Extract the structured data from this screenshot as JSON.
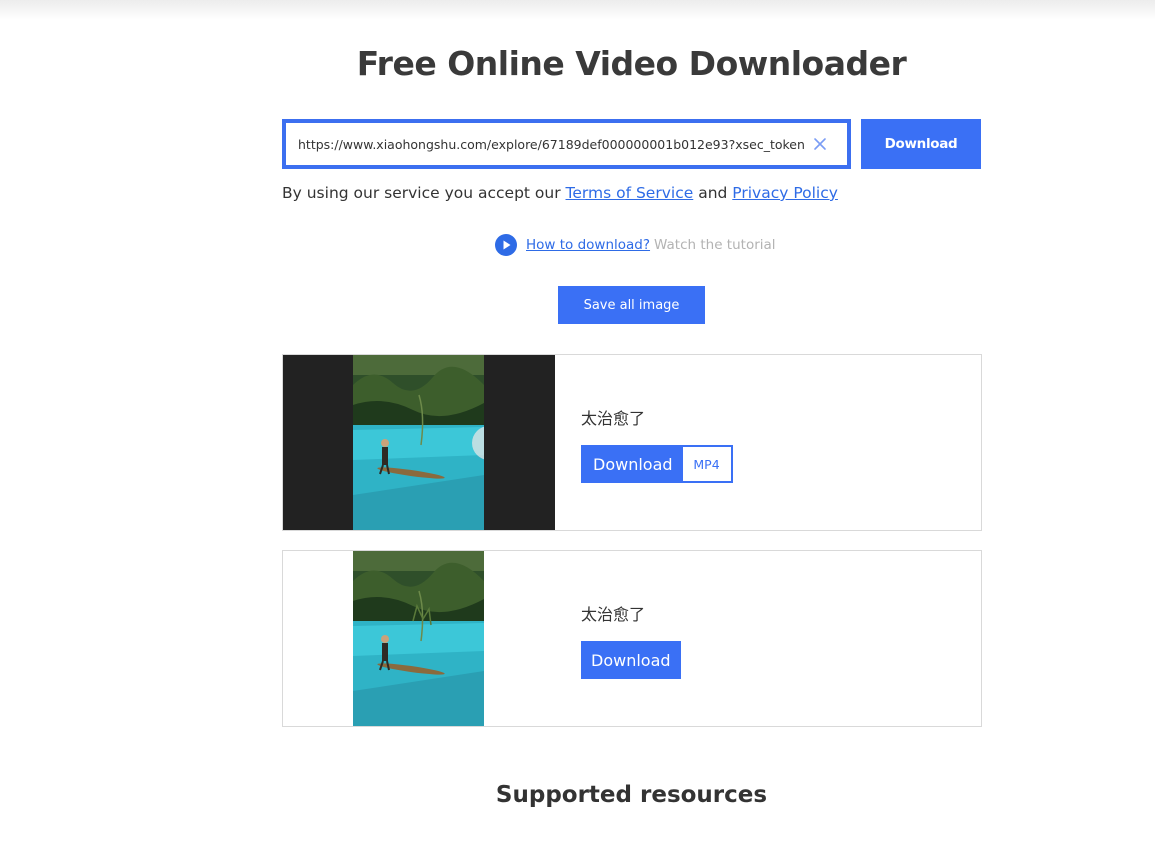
{
  "page": {
    "title": "Free Online Video Downloader",
    "supported_heading": "Supported resources"
  },
  "search": {
    "url_value": "https://www.xiaohongshu.com/explore/67189def000000001b012e93?xsec_token",
    "clear_icon": "close-icon",
    "download_label": "Download"
  },
  "terms": {
    "prefix": "By using our service you accept our ",
    "tos_link": "Terms of Service",
    "and": " and ",
    "privacy_link": "Privacy Policy"
  },
  "howto": {
    "icon": "play-circle-icon",
    "link": "How to download?",
    "hint": "Watch the tutorial"
  },
  "save_all_label": "Save all image",
  "results": [
    {
      "title": "太治愈了",
      "download_label": "Download",
      "format": "MP4",
      "has_video_overlay": true
    },
    {
      "title": "太治愈了",
      "download_label": "Download"
    }
  ],
  "colors": {
    "accent": "#3a70f5",
    "link": "#2e6be6",
    "thumb_bg": "#222222"
  }
}
